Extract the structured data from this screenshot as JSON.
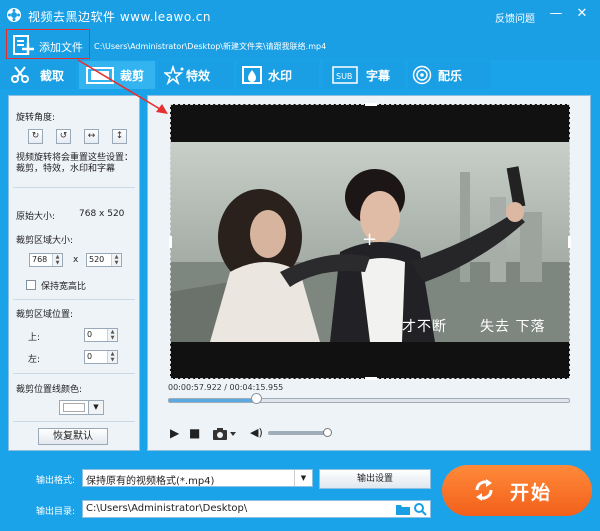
{
  "window": {
    "title": "视频去黑边软件 www.leawo.cn",
    "feedback": "反馈问题",
    "minimize_icon": "minimize-icon",
    "close_icon": "close-icon"
  },
  "toolbar": {
    "add_file_label": "添加文件",
    "file_path": "C:\\Users\\Administrator\\Desktop\\新建文件夹\\请跟我联络.mp4"
  },
  "tabs": [
    {
      "label": "截取",
      "icon": "scissors-icon"
    },
    {
      "label": "裁剪",
      "icon": "crop-icon"
    },
    {
      "label": "特效",
      "icon": "effects-icon"
    },
    {
      "label": "水印",
      "icon": "watermark-icon"
    },
    {
      "label": "字幕",
      "icon": "subtitle-icon"
    },
    {
      "label": "配乐",
      "icon": "music-icon"
    }
  ],
  "sidebar": {
    "rotation_label": "旋转角度:",
    "rotate_hint": "视频旋转将会重置这些设置：裁剪，特效，水印和字幕",
    "original_size_label": "原始大小:",
    "original_size_value": "768 x 520",
    "crop_size_label": "裁剪区域大小:",
    "crop_width": "768",
    "crop_x": "x",
    "crop_height": "520",
    "keep_ratio_label": "保持宽高比",
    "crop_position_label": "裁剪区域位置:",
    "top_label": "上:",
    "top_value": "0",
    "left_label": "左:",
    "left_value": "0",
    "line_color_label": "裁剪位置线颜色:",
    "reset_label": "恢复默认"
  },
  "preview": {
    "timecode": "00:00:57.922 / 00:04:15.955",
    "subtitle_left": "才不断",
    "subtitle_right": "失去 下落",
    "seek_fraction": 0.22,
    "volume_fraction": 0.95
  },
  "bottom": {
    "format_label": "输出格式:",
    "format_value": "保持原有的视频格式(*.mp4)",
    "output_settings": "输出设置",
    "dir_label": "输出目录:",
    "dir_value": "C:\\Users\\Administrator\\Desktop\\",
    "start_label": "开始"
  },
  "colors": {
    "titlebar": "#1a9fe5",
    "start": "#f2601a",
    "annotation": "#e53030"
  }
}
